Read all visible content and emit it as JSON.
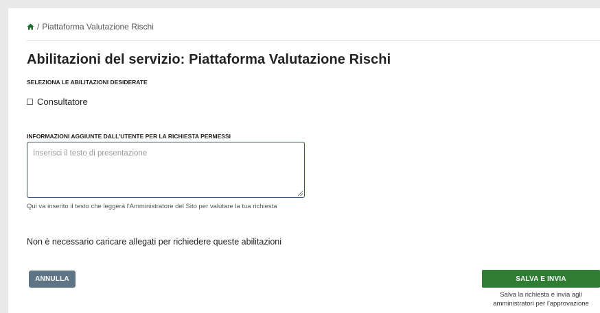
{
  "breadcrumb": {
    "home_icon": "home-icon",
    "separator": "/",
    "current": "Piattaforma Valutazione Rischi"
  },
  "page": {
    "title": "Abilitazioni del servizio: Piattaforma Valutazione Rischi"
  },
  "permissions": {
    "section_label": "SELEZIONA LE ABILITAZIONI DESIDERATE",
    "options": [
      {
        "label": "Consultatore",
        "checked": false
      }
    ]
  },
  "user_info": {
    "section_label": "INFORMAZIONI AGGIUNTE DALL'UTENTE PER LA RICHIESTA PERMESSI",
    "placeholder": "Inserisci il testo di presentazione",
    "value": "",
    "helper": "Qui va inserito il testo che leggerà l'Amministratore del Sito per valutare la tua richiesta"
  },
  "attachments_note": "Non è necessario caricare allegati per richiedere queste abilitazioni",
  "actions": {
    "cancel_label": "ANNULLA",
    "save_label": "SALVA E INVIA",
    "save_caption": "Salva la richiesta e invia agli amministratori per l'approvazione"
  },
  "colors": {
    "primary_green": "#2e7d32",
    "cancel_gray": "#5f7585",
    "textarea_border": "#2f4f88"
  }
}
